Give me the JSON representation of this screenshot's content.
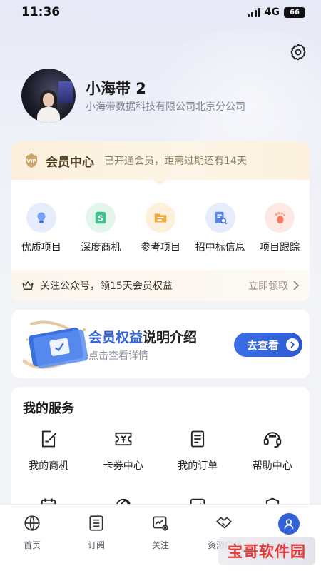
{
  "status_bar": {
    "time": "11:36",
    "network": "4G",
    "battery": "66"
  },
  "profile": {
    "name": "小海带 2",
    "company": "小海带数据科技有限公司北京分公司"
  },
  "member": {
    "title": "会员中心",
    "subtitle": "已开通会员，距离过期还有14天",
    "features": [
      {
        "label": "优质项目",
        "icon": "lightbulb-icon"
      },
      {
        "label": "深度商机",
        "icon": "dollar-s-icon"
      },
      {
        "label": "参考项目",
        "icon": "folder-icon"
      },
      {
        "label": "招中标信息",
        "icon": "document-search-icon"
      },
      {
        "label": "项目跟踪",
        "icon": "footprint-icon"
      }
    ],
    "promo": {
      "text": "关注公众号，领15天会员权益",
      "action": "立即领取"
    }
  },
  "benefit": {
    "title_highlight": "会员权益",
    "title_rest": "说明介绍",
    "subtitle": "点击查看详情",
    "button": "去查看"
  },
  "services": {
    "title": "我的服务",
    "items": [
      {
        "label": "我的商机",
        "icon": "edit-note-icon"
      },
      {
        "label": "卡券中心",
        "icon": "coupon-icon"
      },
      {
        "label": "我的订单",
        "icon": "order-list-icon"
      },
      {
        "label": "帮助中心",
        "icon": "headset-icon"
      }
    ]
  },
  "tabs": [
    {
      "label": "首页",
      "icon": "globe-icon"
    },
    {
      "label": "订阅",
      "icon": "list-icon"
    },
    {
      "label": "关注",
      "icon": "chart-eye-icon"
    },
    {
      "label": "资源广场",
      "icon": "handshake-icon"
    },
    {
      "label": "我的",
      "icon": "user-icon",
      "active": true
    }
  ],
  "watermark": "宝哥软件园",
  "colors": {
    "accent": "#3162d8",
    "gold_bg": "#fbf0dc",
    "watermark": "#e23a3a"
  }
}
